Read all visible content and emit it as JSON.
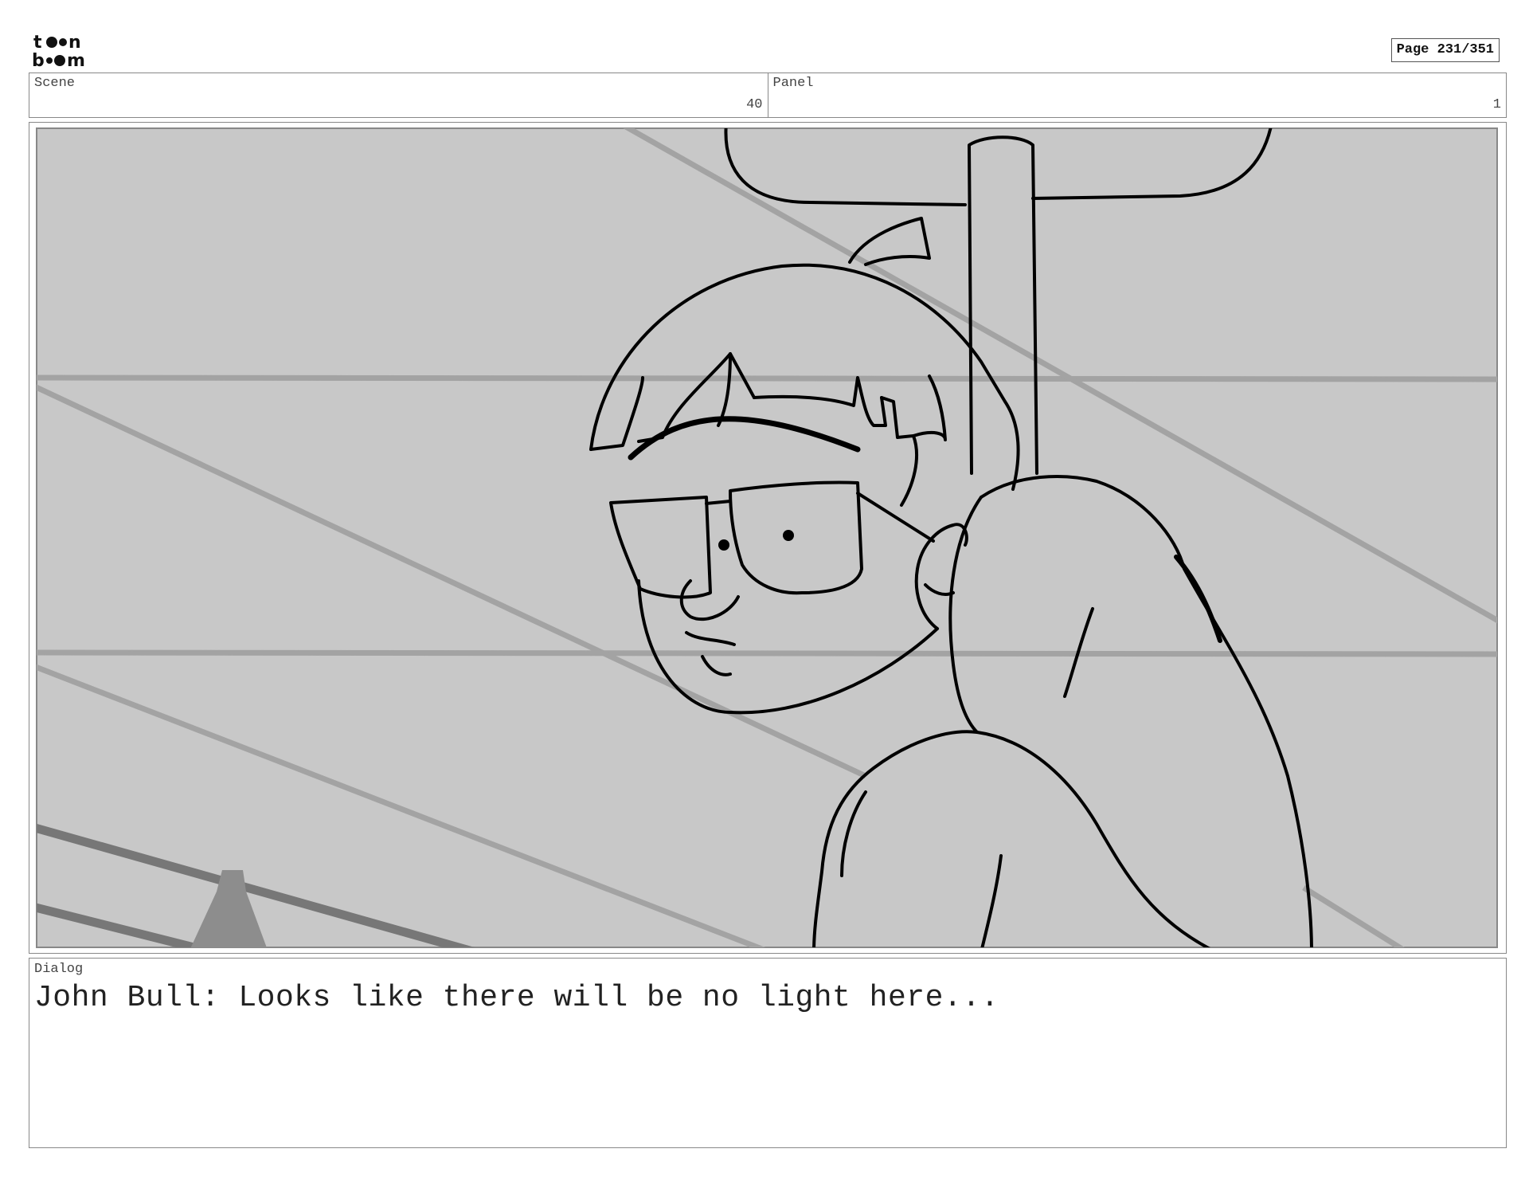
{
  "header": {
    "logo": {
      "icon": "toonboom-logo",
      "text": "toon boom"
    },
    "page_indicator": "Page 231/351"
  },
  "info": {
    "scene": {
      "label": "Scene",
      "value": "40"
    },
    "panel": {
      "label": "Panel",
      "value": "1"
    }
  },
  "panel_image": {
    "icon": "storyboard-drawing",
    "colors": {
      "background": "#c8c8c8",
      "lines": "#000000",
      "guides": "#a3a3a3"
    }
  },
  "dialog": {
    "label": "Dialog",
    "text": "John Bull: Looks like there will be no light here..."
  }
}
